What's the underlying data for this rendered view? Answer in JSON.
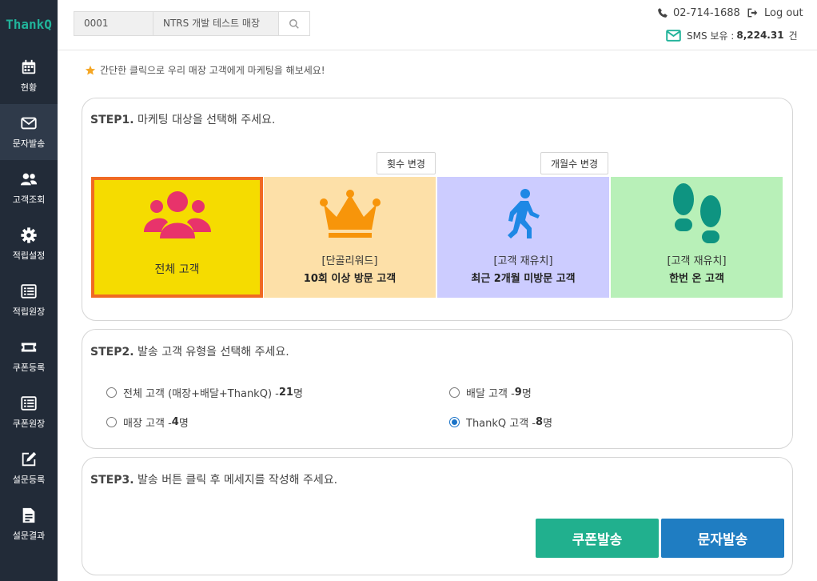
{
  "app": {
    "logo": "ThankQ"
  },
  "sidebar": {
    "items": [
      {
        "label": "현황",
        "icon": "calendar-icon"
      },
      {
        "label": "문자발송",
        "icon": "envelope-icon",
        "active": true
      },
      {
        "label": "고객조회",
        "icon": "users-icon"
      },
      {
        "label": "적립설정",
        "icon": "gear-icon"
      },
      {
        "label": "적립원장",
        "icon": "list-icon"
      },
      {
        "label": "쿠폰등록",
        "icon": "ticket-icon"
      },
      {
        "label": "쿠폰원장",
        "icon": "list-icon"
      },
      {
        "label": "설문등록",
        "icon": "edit-icon"
      },
      {
        "label": "설문결과",
        "icon": "document-icon"
      }
    ]
  },
  "header": {
    "store_code": "0001",
    "store_name": "NTRS 개발 테스트 매장",
    "phone": "02-714-1688",
    "logout": "Log out",
    "sms_label": "SMS 보유 :",
    "sms_count": "8,224.31",
    "sms_unit": "건"
  },
  "notice": "간단한 클릭으로 우리 매장 고객에게 마케팅을 해보세요!",
  "step1": {
    "title_step": "STEP1.",
    "title_text": " 마케팅 대상을 선택해 주세요.",
    "count_change_btn": "횟수 변경",
    "month_change_btn": "개월수 변경",
    "cards": [
      {
        "line1": "전체 고객",
        "line2": "",
        "icon": "group-icon",
        "bg": "#f5dc00",
        "selected": true
      },
      {
        "line1": "[단골리워드]",
        "line2": "10회 이상 방문 고객",
        "icon": "crown-icon",
        "bg": "#fde0a8"
      },
      {
        "line1": "[고객 재유치]",
        "line2": "최근 2개월 미방문 고객",
        "icon": "walking-icon",
        "bg": "#ccccff"
      },
      {
        "line1": "[고객 재유치]",
        "line2": "한번 온 고객",
        "icon": "footprints-icon",
        "bg": "#b8f0b8"
      }
    ]
  },
  "step2": {
    "title_step": "STEP2.",
    "title_text": " 발송 고객 유형을 선택해 주세요.",
    "options": [
      {
        "label": "전체 고객 (매장+배달+ThankQ) - ",
        "count": "21",
        "unit": "명",
        "checked": false
      },
      {
        "label": "배달 고객 - ",
        "count": "9",
        "unit": "명",
        "checked": false
      },
      {
        "label": "매장 고객 - ",
        "count": "4",
        "unit": "명",
        "checked": false
      },
      {
        "label": "ThankQ 고객 - ",
        "count": "8",
        "unit": "명",
        "checked": true
      }
    ]
  },
  "step3": {
    "title_step": "STEP3.",
    "title_text": " 발송 버튼 클릭 후 메세지를 작성해 주세요.",
    "coupon_btn": "쿠폰발송",
    "sms_btn": "문자발송"
  },
  "colors": {
    "sidebar_bg": "#222b38",
    "brand": "#21b39a",
    "coupon_btn": "#21b08e",
    "sms_btn": "#1f7dc2",
    "selected_border": "#f06a22"
  }
}
